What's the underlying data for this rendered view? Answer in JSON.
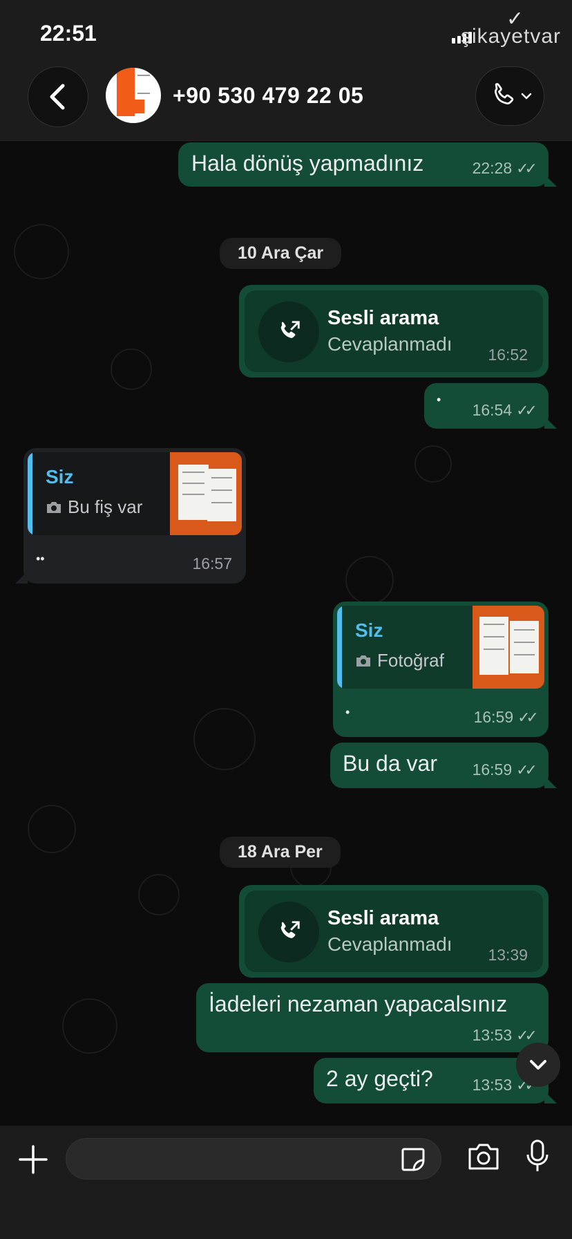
{
  "status_bar": {
    "time": "22:51",
    "watermark": "şikayetvar"
  },
  "header": {
    "contact": "+90 530 479 22 05",
    "avatar_icon": "company-logo",
    "accent": "#f25c19"
  },
  "messages": [
    {
      "type": "text",
      "direction": "out",
      "text": "Hala dönüş yapmadınız",
      "time": "22:28"
    },
    {
      "type": "date",
      "text": "10 Ara Çar"
    },
    {
      "type": "call",
      "direction": "out",
      "title": "Sesli arama",
      "status": "Cevaplanmadı",
      "time": "16:52"
    },
    {
      "type": "text",
      "direction": "out",
      "text": "•",
      "time": "16:54"
    },
    {
      "type": "reply",
      "direction": "in",
      "quote_author": "Siz",
      "quote_text": "Bu fiş var",
      "text": "••",
      "time": "16:57"
    },
    {
      "type": "reply",
      "direction": "out",
      "quote_author": "Siz",
      "quote_text": "Fotoğraf",
      "text": "•",
      "time": "16:59"
    },
    {
      "type": "text",
      "direction": "out",
      "text": "Bu da var",
      "time": "16:59"
    },
    {
      "type": "date",
      "text": "18 Ara Per"
    },
    {
      "type": "call",
      "direction": "out",
      "title": "Sesli arama",
      "status": "Cevaplanmadı",
      "time": "13:39"
    },
    {
      "type": "text",
      "direction": "out",
      "text": "İadeleri nezaman yapacalsınız",
      "time": "13:53"
    },
    {
      "type": "text",
      "direction": "out",
      "text": "2 ay geçti?",
      "time": "13:53"
    }
  ],
  "colors": {
    "outgoing_bubble": "#144d37",
    "incoming_bubble": "#1f2124",
    "quote_accent": "#53bdeb"
  }
}
